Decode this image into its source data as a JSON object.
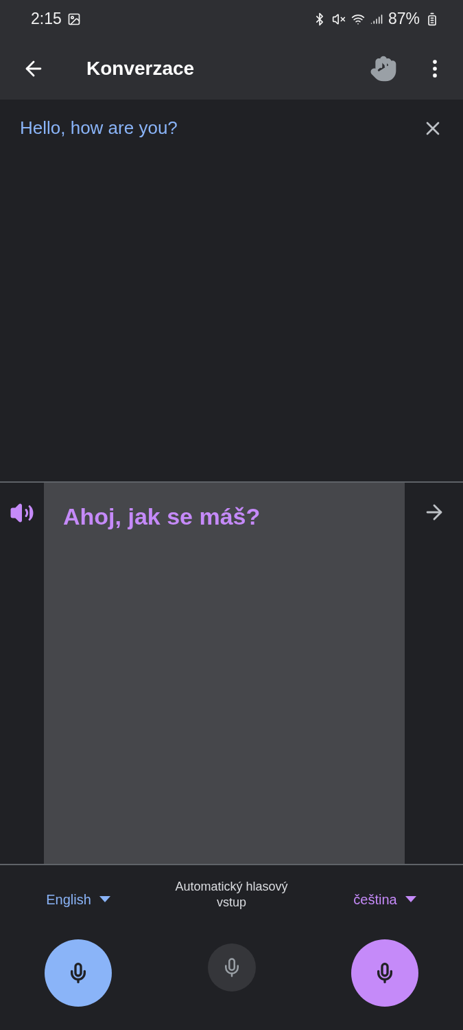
{
  "status_bar": {
    "time": "2:15",
    "battery": "87%"
  },
  "toolbar": {
    "title": "Konverzace"
  },
  "source": {
    "text": "Hello, how are you?"
  },
  "translation": {
    "text": "Ahoj, jak se máš?"
  },
  "auto_voice": {
    "label": "Automatický hlasový vstup"
  },
  "languages": [
    {
      "name": "English",
      "color": "#8ab4f8"
    },
    {
      "name": "čeština",
      "color": "#c58af9"
    }
  ]
}
